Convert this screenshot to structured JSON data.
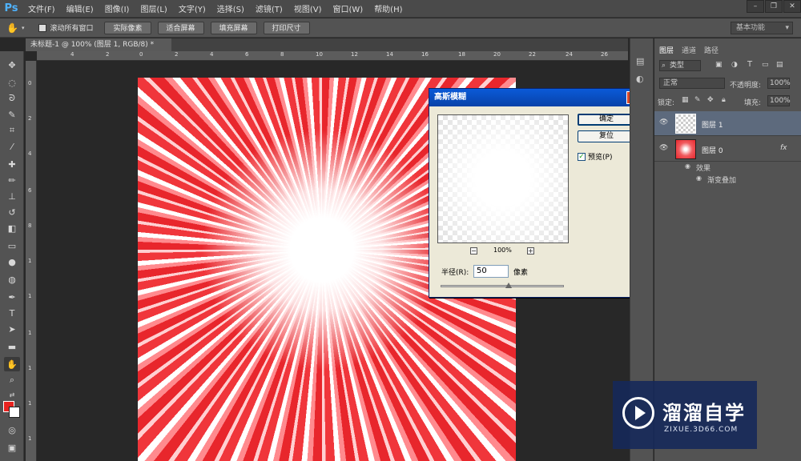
{
  "app": {
    "logo": "Ps"
  },
  "menu": [
    "文件(F)",
    "编辑(E)",
    "图像(I)",
    "图层(L)",
    "文字(Y)",
    "选择(S)",
    "滤镜(T)",
    "视图(V)",
    "窗口(W)",
    "帮助(H)"
  ],
  "options": {
    "scroll_all": "滚动所有窗口",
    "buttons": [
      "实际像素",
      "适合屏幕",
      "填充屏幕",
      "打印尺寸"
    ],
    "workspace": "基本功能"
  },
  "document_tab": "未标题-1 @ 100% (图层 1, RGB/8) *",
  "ruler_h": [
    "4",
    "2",
    "0",
    "2",
    "4",
    "6",
    "8",
    "10",
    "12",
    "14",
    "16",
    "18",
    "20",
    "22",
    "24",
    "26"
  ],
  "ruler_v": [
    "0",
    "2",
    "4",
    "6",
    "8",
    "1",
    "1",
    "1",
    "1",
    "1",
    "1"
  ],
  "dialog": {
    "title": "高斯模糊",
    "ok": "确定",
    "reset": "复位",
    "preview_label": "预览(P)",
    "preview_checked": true,
    "zoom": "100%",
    "radius_label": "半径(R):",
    "radius_value": "50",
    "unit": "像素",
    "slider_fraction": 0.55
  },
  "layers_panel": {
    "tabs": [
      "图层",
      "通道",
      "路径"
    ],
    "kind": "类型",
    "blend_mode": "正常",
    "opacity_label": "不透明度:",
    "opacity": "100%",
    "lock_label": "锁定:",
    "fill_label": "填充:",
    "fill": "100%",
    "layers": [
      {
        "name": "图层 1",
        "selected": true
      },
      {
        "name": "图层 0",
        "selected": false,
        "fx": "fx"
      }
    ],
    "effects_label": "效果",
    "effect_item": "渐变叠加"
  },
  "colors": {
    "foreground": "#e8231f",
    "background": "#ffffff",
    "accent": "#0a5ad8"
  },
  "watermark": {
    "brand": "溜溜自学",
    "url": "ZIXUE.3D66.COM"
  }
}
